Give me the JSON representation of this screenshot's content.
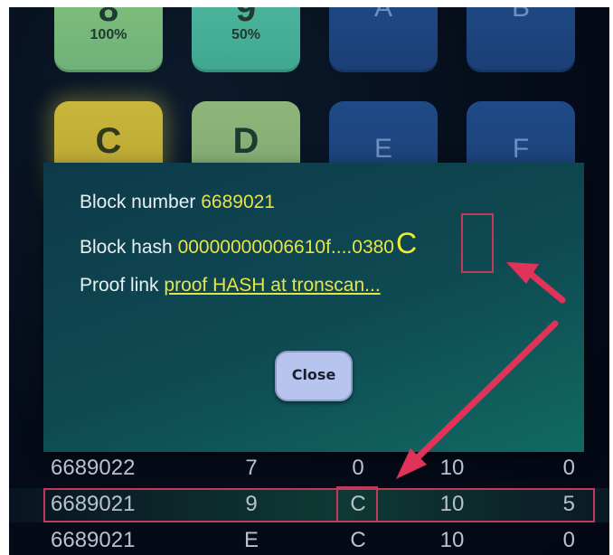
{
  "tiles_top": [
    {
      "symbol": "8",
      "percent": "100%"
    },
    {
      "symbol": "9",
      "percent": "50%"
    },
    {
      "symbol": "A"
    },
    {
      "symbol": "B"
    }
  ],
  "tiles_second": [
    {
      "symbol": "C"
    },
    {
      "symbol": "D"
    },
    {
      "symbol": "E"
    },
    {
      "symbol": "F"
    }
  ],
  "modal": {
    "block_number_label": "Block number",
    "block_number_value": "6689021",
    "block_hash_label": "Block hash",
    "block_hash_value": "00000000006610f....0380",
    "block_hash_last_char": "C",
    "proof_label": "Proof link",
    "proof_link_text": "proof HASH at tronscan...",
    "close_label": "Close"
  },
  "table_rows": [
    {
      "block": "6689022",
      "num": "7",
      "symbol": "0",
      "bet": "10",
      "win": "0"
    },
    {
      "block": "6689021",
      "num": "9",
      "symbol": "C",
      "bet": "10",
      "win": "5"
    },
    {
      "block": "6689021",
      "num": "E",
      "symbol": "C",
      "bet": "10",
      "win": "0"
    }
  ],
  "colors": {
    "highlight_value": "#e6e44a",
    "annotation_red": "#d9355a",
    "modal_bg": "#0f4a52",
    "close_button": "#b7c4ee"
  }
}
